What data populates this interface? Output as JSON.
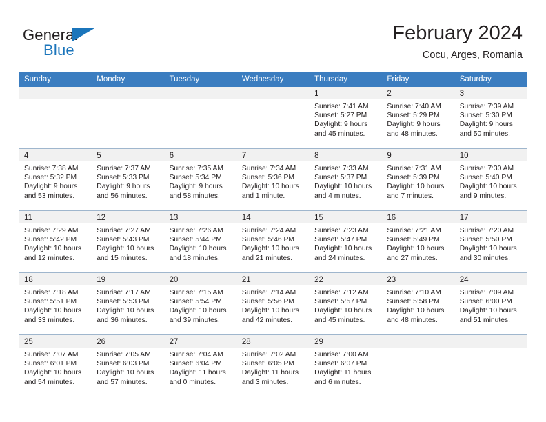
{
  "brand": {
    "word1": "General",
    "word2": "Blue",
    "flag_icon": "triangle-flag-icon",
    "accent_color": "#1b75bb"
  },
  "header": {
    "month_title": "February 2024",
    "location": "Cocu, Arges, Romania"
  },
  "theme": {
    "header_row_bg": "#3b7dc0",
    "header_row_text": "#ffffff",
    "day_number_band_bg": "#f1f1f1",
    "week_separator": "#9fb6cd",
    "text_color": "#231f20"
  },
  "calendar": {
    "weekdays": [
      "Sunday",
      "Monday",
      "Tuesday",
      "Wednesday",
      "Thursday",
      "Friday",
      "Saturday"
    ],
    "weeks": [
      [
        {
          "empty": true
        },
        {
          "empty": true
        },
        {
          "empty": true
        },
        {
          "empty": true
        },
        {
          "day": "1",
          "sunrise": "Sunrise: 7:41 AM",
          "sunset": "Sunset: 5:27 PM",
          "daylight1": "Daylight: 9 hours",
          "daylight2": "and 45 minutes."
        },
        {
          "day": "2",
          "sunrise": "Sunrise: 7:40 AM",
          "sunset": "Sunset: 5:29 PM",
          "daylight1": "Daylight: 9 hours",
          "daylight2": "and 48 minutes."
        },
        {
          "day": "3",
          "sunrise": "Sunrise: 7:39 AM",
          "sunset": "Sunset: 5:30 PM",
          "daylight1": "Daylight: 9 hours",
          "daylight2": "and 50 minutes."
        }
      ],
      [
        {
          "day": "4",
          "sunrise": "Sunrise: 7:38 AM",
          "sunset": "Sunset: 5:32 PM",
          "daylight1": "Daylight: 9 hours",
          "daylight2": "and 53 minutes."
        },
        {
          "day": "5",
          "sunrise": "Sunrise: 7:37 AM",
          "sunset": "Sunset: 5:33 PM",
          "daylight1": "Daylight: 9 hours",
          "daylight2": "and 56 minutes."
        },
        {
          "day": "6",
          "sunrise": "Sunrise: 7:35 AM",
          "sunset": "Sunset: 5:34 PM",
          "daylight1": "Daylight: 9 hours",
          "daylight2": "and 58 minutes."
        },
        {
          "day": "7",
          "sunrise": "Sunrise: 7:34 AM",
          "sunset": "Sunset: 5:36 PM",
          "daylight1": "Daylight: 10 hours",
          "daylight2": "and 1 minute."
        },
        {
          "day": "8",
          "sunrise": "Sunrise: 7:33 AM",
          "sunset": "Sunset: 5:37 PM",
          "daylight1": "Daylight: 10 hours",
          "daylight2": "and 4 minutes."
        },
        {
          "day": "9",
          "sunrise": "Sunrise: 7:31 AM",
          "sunset": "Sunset: 5:39 PM",
          "daylight1": "Daylight: 10 hours",
          "daylight2": "and 7 minutes."
        },
        {
          "day": "10",
          "sunrise": "Sunrise: 7:30 AM",
          "sunset": "Sunset: 5:40 PM",
          "daylight1": "Daylight: 10 hours",
          "daylight2": "and 9 minutes."
        }
      ],
      [
        {
          "day": "11",
          "sunrise": "Sunrise: 7:29 AM",
          "sunset": "Sunset: 5:42 PM",
          "daylight1": "Daylight: 10 hours",
          "daylight2": "and 12 minutes."
        },
        {
          "day": "12",
          "sunrise": "Sunrise: 7:27 AM",
          "sunset": "Sunset: 5:43 PM",
          "daylight1": "Daylight: 10 hours",
          "daylight2": "and 15 minutes."
        },
        {
          "day": "13",
          "sunrise": "Sunrise: 7:26 AM",
          "sunset": "Sunset: 5:44 PM",
          "daylight1": "Daylight: 10 hours",
          "daylight2": "and 18 minutes."
        },
        {
          "day": "14",
          "sunrise": "Sunrise: 7:24 AM",
          "sunset": "Sunset: 5:46 PM",
          "daylight1": "Daylight: 10 hours",
          "daylight2": "and 21 minutes."
        },
        {
          "day": "15",
          "sunrise": "Sunrise: 7:23 AM",
          "sunset": "Sunset: 5:47 PM",
          "daylight1": "Daylight: 10 hours",
          "daylight2": "and 24 minutes."
        },
        {
          "day": "16",
          "sunrise": "Sunrise: 7:21 AM",
          "sunset": "Sunset: 5:49 PM",
          "daylight1": "Daylight: 10 hours",
          "daylight2": "and 27 minutes."
        },
        {
          "day": "17",
          "sunrise": "Sunrise: 7:20 AM",
          "sunset": "Sunset: 5:50 PM",
          "daylight1": "Daylight: 10 hours",
          "daylight2": "and 30 minutes."
        }
      ],
      [
        {
          "day": "18",
          "sunrise": "Sunrise: 7:18 AM",
          "sunset": "Sunset: 5:51 PM",
          "daylight1": "Daylight: 10 hours",
          "daylight2": "and 33 minutes."
        },
        {
          "day": "19",
          "sunrise": "Sunrise: 7:17 AM",
          "sunset": "Sunset: 5:53 PM",
          "daylight1": "Daylight: 10 hours",
          "daylight2": "and 36 minutes."
        },
        {
          "day": "20",
          "sunrise": "Sunrise: 7:15 AM",
          "sunset": "Sunset: 5:54 PM",
          "daylight1": "Daylight: 10 hours",
          "daylight2": "and 39 minutes."
        },
        {
          "day": "21",
          "sunrise": "Sunrise: 7:14 AM",
          "sunset": "Sunset: 5:56 PM",
          "daylight1": "Daylight: 10 hours",
          "daylight2": "and 42 minutes."
        },
        {
          "day": "22",
          "sunrise": "Sunrise: 7:12 AM",
          "sunset": "Sunset: 5:57 PM",
          "daylight1": "Daylight: 10 hours",
          "daylight2": "and 45 minutes."
        },
        {
          "day": "23",
          "sunrise": "Sunrise: 7:10 AM",
          "sunset": "Sunset: 5:58 PM",
          "daylight1": "Daylight: 10 hours",
          "daylight2": "and 48 minutes."
        },
        {
          "day": "24",
          "sunrise": "Sunrise: 7:09 AM",
          "sunset": "Sunset: 6:00 PM",
          "daylight1": "Daylight: 10 hours",
          "daylight2": "and 51 minutes."
        }
      ],
      [
        {
          "day": "25",
          "sunrise": "Sunrise: 7:07 AM",
          "sunset": "Sunset: 6:01 PM",
          "daylight1": "Daylight: 10 hours",
          "daylight2": "and 54 minutes."
        },
        {
          "day": "26",
          "sunrise": "Sunrise: 7:05 AM",
          "sunset": "Sunset: 6:03 PM",
          "daylight1": "Daylight: 10 hours",
          "daylight2": "and 57 minutes."
        },
        {
          "day": "27",
          "sunrise": "Sunrise: 7:04 AM",
          "sunset": "Sunset: 6:04 PM",
          "daylight1": "Daylight: 11 hours",
          "daylight2": "and 0 minutes."
        },
        {
          "day": "28",
          "sunrise": "Sunrise: 7:02 AM",
          "sunset": "Sunset: 6:05 PM",
          "daylight1": "Daylight: 11 hours",
          "daylight2": "and 3 minutes."
        },
        {
          "day": "29",
          "sunrise": "Sunrise: 7:00 AM",
          "sunset": "Sunset: 6:07 PM",
          "daylight1": "Daylight: 11 hours",
          "daylight2": "and 6 minutes."
        },
        {
          "empty": true
        },
        {
          "empty": true
        }
      ]
    ]
  }
}
